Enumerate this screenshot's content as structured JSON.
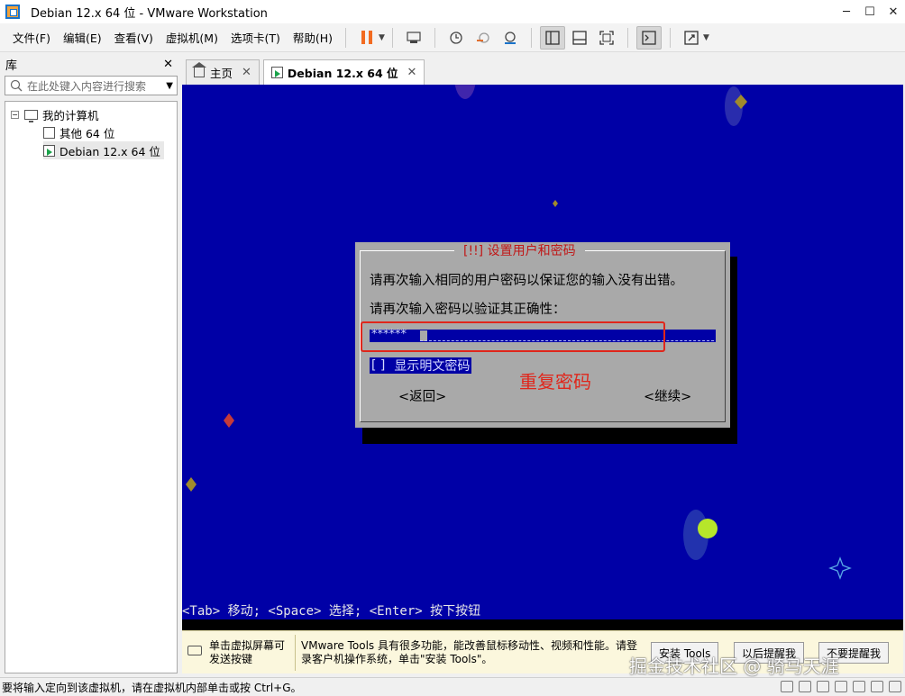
{
  "window": {
    "title": "Debian 12.x 64 位 - VMware Workstation"
  },
  "menu": [
    {
      "label": "文件(F)"
    },
    {
      "label": "编辑(E)"
    },
    {
      "label": "查看(V)"
    },
    {
      "label": "虚拟机(M)"
    },
    {
      "label": "选项卡(T)"
    },
    {
      "label": "帮助(H)"
    }
  ],
  "library": {
    "title": "库",
    "search_placeholder": "在此处键入内容进行搜索",
    "tree": {
      "root": "我的计算机",
      "children": [
        {
          "label": "其他 64 位"
        },
        {
          "label": "Debian 12.x 64 位"
        }
      ]
    }
  },
  "tabs": [
    {
      "label": "主页"
    },
    {
      "label": "Debian 12.x 64 位"
    }
  ],
  "installer": {
    "dialog_title": "[!!] 设置用户和密码",
    "prompt_line1": "请再次输入相同的用户密码以保证您的输入没有出错。",
    "prompt_line2": "请再次输入密码以验证其正确性：",
    "password_mask": "******",
    "show_password_checkbox": "[ ]",
    "show_password_label": "显示明文密码",
    "back_button": "<返回>",
    "continue_button": "<继续>",
    "annotation": "重复密码",
    "key_hint": "<Tab> 移动; <Space> 选择; <Enter> 按下按钮"
  },
  "tools_banner": {
    "left_text": "单击虚拟屏幕可发送按键",
    "message": "VMware Tools 具有很多功能，能改善鼠标移动性、视频和性能。请登录客户机操作系统，单击\"安装 Tools\"。",
    "install_button": "安装 Tools",
    "remind_later_button": "以后提醒我",
    "never_remind_button": "不要提醒我"
  },
  "watermark": "掘金技术社区 @ 骑马天涯",
  "status_bar": {
    "text": "要将输入定向到该虚拟机，请在虚拟机内部单击或按 Ctrl+G。"
  },
  "colors": {
    "console_bg": "#0000a6",
    "dialog_bg": "#a9a9a9",
    "annotation_red": "#e0261b",
    "pause_orange": "#f26b21"
  }
}
